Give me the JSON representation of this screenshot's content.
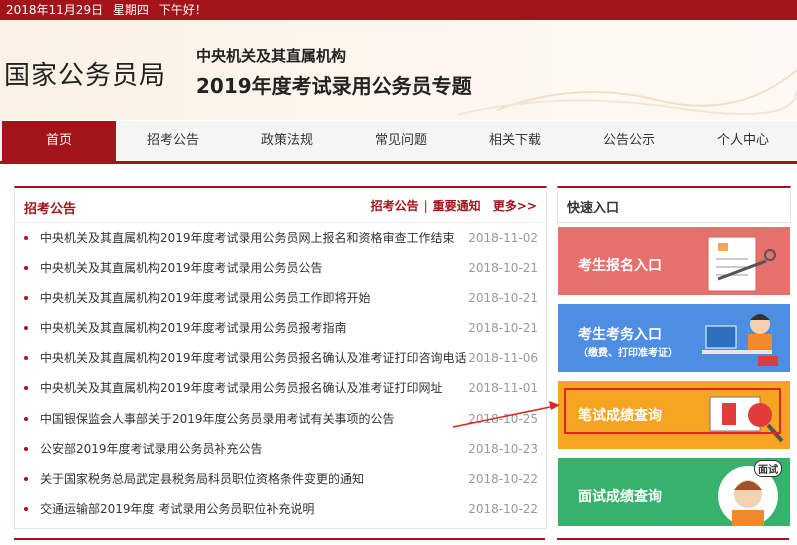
{
  "topbar": {
    "date": "2018年11月29日",
    "weekday": "星期四",
    "greeting": "下午好！"
  },
  "header": {
    "agency": "国家公务员局",
    "subtitle1": "中央机关及其直属机构",
    "subtitle2": "2019年度考试录用公务员专题"
  },
  "nav": {
    "items": [
      {
        "label": "首页"
      },
      {
        "label": "招考公告"
      },
      {
        "label": "政策法规"
      },
      {
        "label": "常见问题"
      },
      {
        "label": "相关下载"
      },
      {
        "label": "公告公示"
      },
      {
        "label": "个人中心"
      }
    ]
  },
  "notices": {
    "title": "招考公告",
    "link1": "招考公告",
    "separator": "|",
    "link2": "重要通知",
    "more": "更多>>",
    "items": [
      {
        "title": "中央机关及其直属机构2019年度考试录用公务员网上报名和资格审查工作结束",
        "date": "2018-11-02"
      },
      {
        "title": "中央机关及其直属机构2019年度考试录用公务员公告",
        "date": "2018-10-21"
      },
      {
        "title": "中央机关及其直属机构2019年度考试录用公务员工作即将开始",
        "date": "2018-10-21"
      },
      {
        "title": "中央机关及其直属机构2019年度考试录用公务员报考指南",
        "date": "2018-10-21"
      },
      {
        "title": "中央机关及其直属机构2019年度考试录用公务员报名确认及准考证打印咨询电话",
        "date": "2018-11-06"
      },
      {
        "title": "中央机关及其直属机构2019年度考试录用公务员报名确认及准考证打印网址",
        "date": "2018-11-01"
      },
      {
        "title": "中国银保监会人事部关于2019年度公务员录用考试有关事项的公告",
        "date": "2018-10-25"
      },
      {
        "title": "公安部2019年度考试录用公务员补充公告",
        "date": "2018-10-23"
      },
      {
        "title": "关于国家税务总局武定县税务局科员职位资格条件变更的通知",
        "date": "2018-10-22"
      },
      {
        "title": "交通运输部2019年度 考试录用公务员职位补充说明",
        "date": "2018-10-22"
      }
    ]
  },
  "quick": {
    "title": "快速入口",
    "btn1": "考生报名入口",
    "btn2": "考生考务入口",
    "btn2_sub": "（缴费、打印准考证）",
    "btn3": "笔试成绩查询",
    "btn4": "面试成绩查询",
    "btn4_badge": "面试"
  },
  "colors": {
    "brand": "#a3131a",
    "btn1": "#e5706c",
    "btn2": "#4e8ee2",
    "btn3": "#f5a521",
    "btn4": "#36b26c",
    "highlight": "#e0251e"
  }
}
